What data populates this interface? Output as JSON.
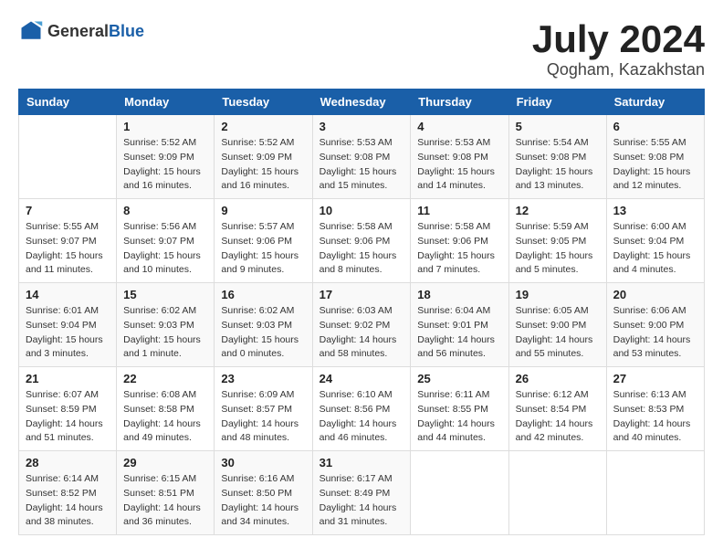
{
  "header": {
    "logo_general": "General",
    "logo_blue": "Blue",
    "title": "July 2024",
    "subtitle": "Qogham, Kazakhstan"
  },
  "calendar": {
    "days_of_week": [
      "Sunday",
      "Monday",
      "Tuesday",
      "Wednesday",
      "Thursday",
      "Friday",
      "Saturday"
    ],
    "weeks": [
      [
        {
          "day": "",
          "info": ""
        },
        {
          "day": "1",
          "info": "Sunrise: 5:52 AM\nSunset: 9:09 PM\nDaylight: 15 hours\nand 16 minutes."
        },
        {
          "day": "2",
          "info": "Sunrise: 5:52 AM\nSunset: 9:09 PM\nDaylight: 15 hours\nand 16 minutes."
        },
        {
          "day": "3",
          "info": "Sunrise: 5:53 AM\nSunset: 9:08 PM\nDaylight: 15 hours\nand 15 minutes."
        },
        {
          "day": "4",
          "info": "Sunrise: 5:53 AM\nSunset: 9:08 PM\nDaylight: 15 hours\nand 14 minutes."
        },
        {
          "day": "5",
          "info": "Sunrise: 5:54 AM\nSunset: 9:08 PM\nDaylight: 15 hours\nand 13 minutes."
        },
        {
          "day": "6",
          "info": "Sunrise: 5:55 AM\nSunset: 9:08 PM\nDaylight: 15 hours\nand 12 minutes."
        }
      ],
      [
        {
          "day": "7",
          "info": "Sunrise: 5:55 AM\nSunset: 9:07 PM\nDaylight: 15 hours\nand 11 minutes."
        },
        {
          "day": "8",
          "info": "Sunrise: 5:56 AM\nSunset: 9:07 PM\nDaylight: 15 hours\nand 10 minutes."
        },
        {
          "day": "9",
          "info": "Sunrise: 5:57 AM\nSunset: 9:06 PM\nDaylight: 15 hours\nand 9 minutes."
        },
        {
          "day": "10",
          "info": "Sunrise: 5:58 AM\nSunset: 9:06 PM\nDaylight: 15 hours\nand 8 minutes."
        },
        {
          "day": "11",
          "info": "Sunrise: 5:58 AM\nSunset: 9:06 PM\nDaylight: 15 hours\nand 7 minutes."
        },
        {
          "day": "12",
          "info": "Sunrise: 5:59 AM\nSunset: 9:05 PM\nDaylight: 15 hours\nand 5 minutes."
        },
        {
          "day": "13",
          "info": "Sunrise: 6:00 AM\nSunset: 9:04 PM\nDaylight: 15 hours\nand 4 minutes."
        }
      ],
      [
        {
          "day": "14",
          "info": "Sunrise: 6:01 AM\nSunset: 9:04 PM\nDaylight: 15 hours\nand 3 minutes."
        },
        {
          "day": "15",
          "info": "Sunrise: 6:02 AM\nSunset: 9:03 PM\nDaylight: 15 hours\nand 1 minute."
        },
        {
          "day": "16",
          "info": "Sunrise: 6:02 AM\nSunset: 9:03 PM\nDaylight: 15 hours\nand 0 minutes."
        },
        {
          "day": "17",
          "info": "Sunrise: 6:03 AM\nSunset: 9:02 PM\nDaylight: 14 hours\nand 58 minutes."
        },
        {
          "day": "18",
          "info": "Sunrise: 6:04 AM\nSunset: 9:01 PM\nDaylight: 14 hours\nand 56 minutes."
        },
        {
          "day": "19",
          "info": "Sunrise: 6:05 AM\nSunset: 9:00 PM\nDaylight: 14 hours\nand 55 minutes."
        },
        {
          "day": "20",
          "info": "Sunrise: 6:06 AM\nSunset: 9:00 PM\nDaylight: 14 hours\nand 53 minutes."
        }
      ],
      [
        {
          "day": "21",
          "info": "Sunrise: 6:07 AM\nSunset: 8:59 PM\nDaylight: 14 hours\nand 51 minutes."
        },
        {
          "day": "22",
          "info": "Sunrise: 6:08 AM\nSunset: 8:58 PM\nDaylight: 14 hours\nand 49 minutes."
        },
        {
          "day": "23",
          "info": "Sunrise: 6:09 AM\nSunset: 8:57 PM\nDaylight: 14 hours\nand 48 minutes."
        },
        {
          "day": "24",
          "info": "Sunrise: 6:10 AM\nSunset: 8:56 PM\nDaylight: 14 hours\nand 46 minutes."
        },
        {
          "day": "25",
          "info": "Sunrise: 6:11 AM\nSunset: 8:55 PM\nDaylight: 14 hours\nand 44 minutes."
        },
        {
          "day": "26",
          "info": "Sunrise: 6:12 AM\nSunset: 8:54 PM\nDaylight: 14 hours\nand 42 minutes."
        },
        {
          "day": "27",
          "info": "Sunrise: 6:13 AM\nSunset: 8:53 PM\nDaylight: 14 hours\nand 40 minutes."
        }
      ],
      [
        {
          "day": "28",
          "info": "Sunrise: 6:14 AM\nSunset: 8:52 PM\nDaylight: 14 hours\nand 38 minutes."
        },
        {
          "day": "29",
          "info": "Sunrise: 6:15 AM\nSunset: 8:51 PM\nDaylight: 14 hours\nand 36 minutes."
        },
        {
          "day": "30",
          "info": "Sunrise: 6:16 AM\nSunset: 8:50 PM\nDaylight: 14 hours\nand 34 minutes."
        },
        {
          "day": "31",
          "info": "Sunrise: 6:17 AM\nSunset: 8:49 PM\nDaylight: 14 hours\nand 31 minutes."
        },
        {
          "day": "",
          "info": ""
        },
        {
          "day": "",
          "info": ""
        },
        {
          "day": "",
          "info": ""
        }
      ]
    ]
  }
}
